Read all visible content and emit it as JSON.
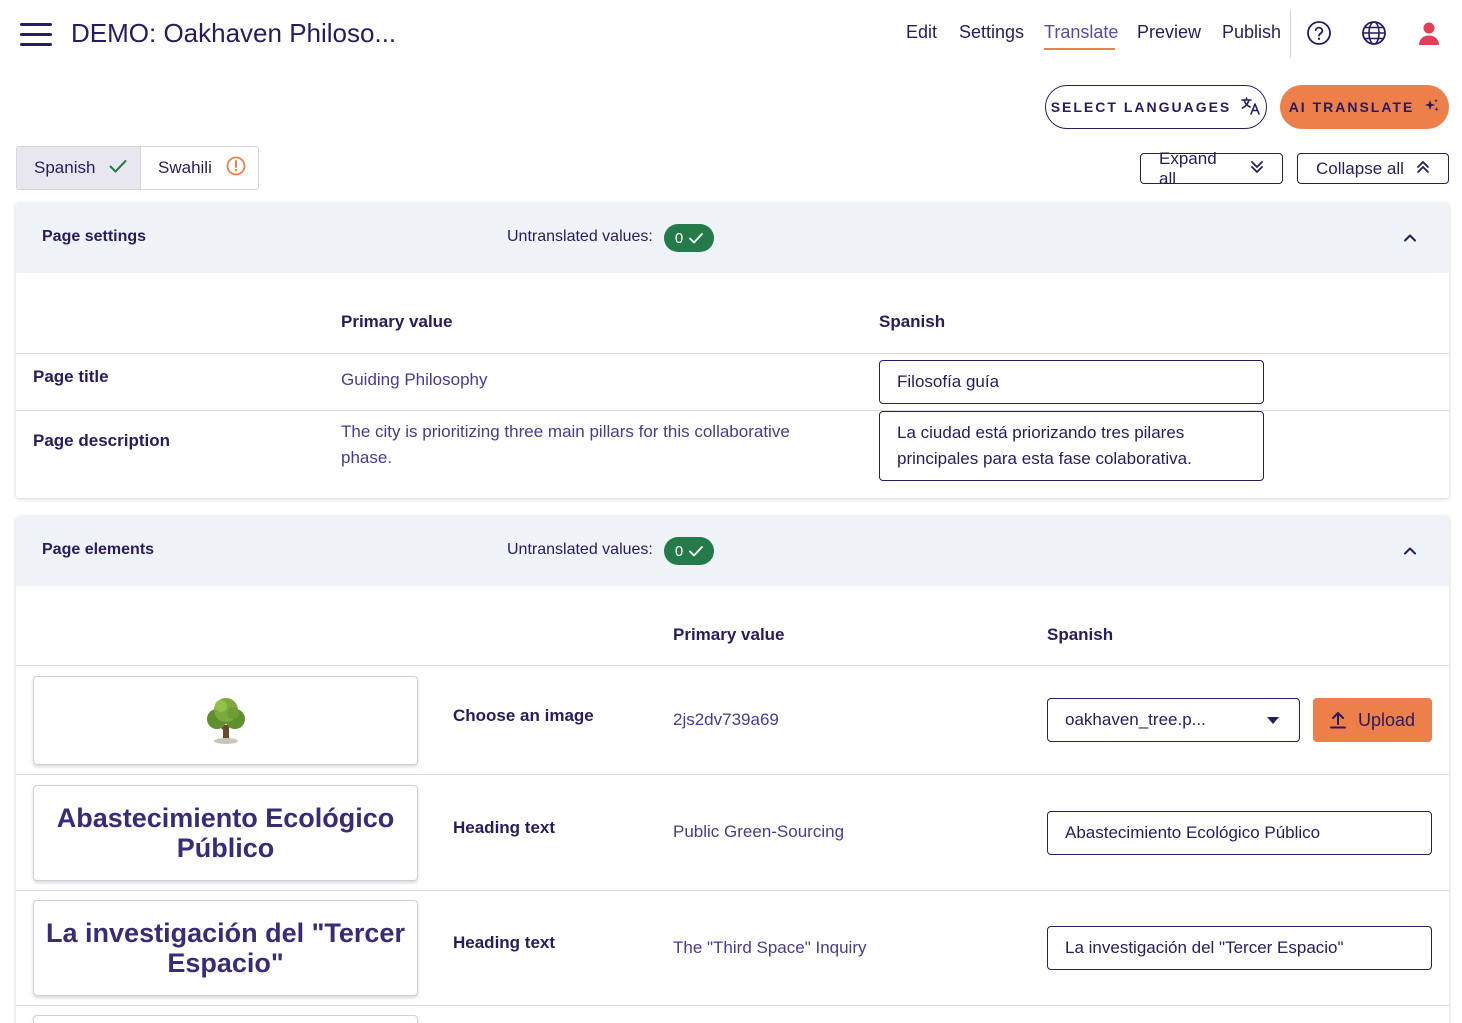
{
  "header": {
    "title": "DEMO: Oakhaven Philoso...",
    "nav": [
      {
        "label": "Edit"
      },
      {
        "label": "Settings"
      },
      {
        "label": "Translate"
      },
      {
        "label": "Preview"
      },
      {
        "label": "Publish"
      }
    ],
    "active_nav": "Translate",
    "icons": [
      "help-icon",
      "globe-icon",
      "user-icon"
    ]
  },
  "actions": {
    "select_languages": "SELECT LANGUAGES",
    "ai_translate": "AI TRANSLATE"
  },
  "languages": {
    "tabs": [
      {
        "label": "Spanish",
        "status": "complete"
      },
      {
        "label": "Swahili",
        "status": "warning"
      }
    ],
    "selected": "Spanish"
  },
  "controls": {
    "expand_all": "Expand all",
    "collapse_all": "Collapse all"
  },
  "page_settings": {
    "title": "Page settings",
    "untranslated_label": "Untranslated values:",
    "untranslated_count": "0",
    "col_primary": "Primary value",
    "col_language": "Spanish",
    "rows": [
      {
        "label": "Page title",
        "primary": "Guiding Philosophy",
        "translation": "Filosofía guía"
      },
      {
        "label": "Page description",
        "primary": "The city is prioritizing three main pillars for this collaborative phase.",
        "translation": "La ciudad está priorizando tres pilares principales para esta fase colaborativa."
      }
    ]
  },
  "page_elements": {
    "title": "Page elements",
    "untranslated_label": "Untranslated values:",
    "untranslated_count": "0",
    "col_primary": "Primary value",
    "col_language": "Spanish",
    "rows": [
      {
        "label": "Choose an image",
        "primary": "2js2dv739a69",
        "translation": "oakhaven_tree.p...",
        "preview": "tree-icon",
        "upload_label": "Upload"
      },
      {
        "label": "Heading text",
        "primary": "Public Green-Sourcing",
        "translation": "Abastecimiento Ecológico Público",
        "preview": "Abastecimiento Ecológico Público"
      },
      {
        "label": "Heading text",
        "primary": "The \"Third Space\" Inquiry",
        "translation": "La investigación del \"Tercer Espacio\"",
        "preview": "La investigación del \"Tercer Espacio\""
      }
    ]
  },
  "colors": {
    "text": "#2a1a5e",
    "accent_orange": "#ec7f4a",
    "success_green": "#257a4a",
    "header_bg": "#eef3f8",
    "user_icon": "#e0405a"
  }
}
